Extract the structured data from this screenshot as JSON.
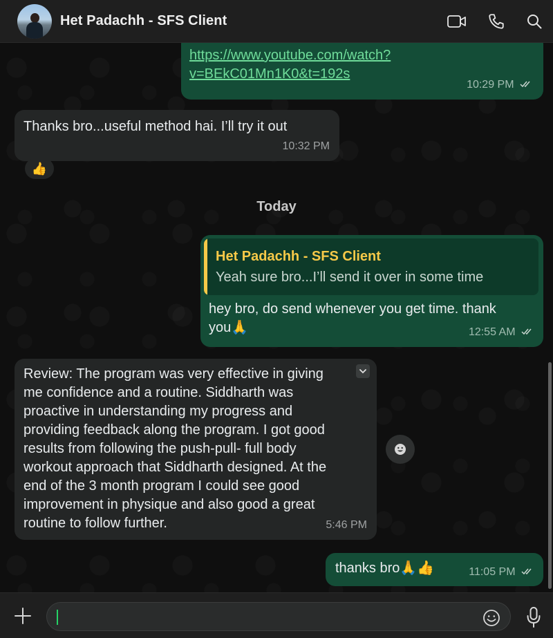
{
  "header": {
    "contact_name": "Het Padachh - SFS Client",
    "icons": [
      "video-call-icon",
      "voice-call-icon",
      "search-icon"
    ]
  },
  "messages": [
    {
      "direction": "out",
      "link_line1": "https://www.youtube.com/watch?",
      "link_line2": "v=BEkC01Mn1K0&t=192s",
      "time": "10:29 PM",
      "status": "read"
    },
    {
      "direction": "in",
      "text": "Thanks bro...useful method hai. I’ll try it out",
      "time": "10:32 PM",
      "reaction": "👍"
    },
    {
      "direction": "out",
      "quote_author": "Het Padachh - SFS Client",
      "quote_text": "Yeah sure bro...I’ll send it over in some time",
      "text_line1": "hey bro, do send whenever you get time. thank",
      "text_line2": "you🙏",
      "time": "12:55 AM",
      "status": "read"
    },
    {
      "direction": "in",
      "lines": [
        "Review: The program was very effective in giving",
        "me confidence and a routine. Siddharth was",
        "proactive in understanding my progress and",
        "providing feedback along the program. I got good",
        "results from following the push-pull- full body",
        "workout approach that Siddharth designed. At the",
        "end of the 3 month program I could see good",
        "improvement in physique and also good a great",
        "routine to follow further."
      ],
      "time": "5:46 PM"
    },
    {
      "direction": "out",
      "text": "thanks bro🙏👍",
      "time": "11:05 PM",
      "status": "read"
    }
  ],
  "day_separator": "Today",
  "composer": {
    "value": "",
    "placeholder": ""
  },
  "colors": {
    "outgoing_bubble": "#144d37",
    "incoming_bubble": "#242626",
    "quote_accent": "#f7c948",
    "link": "#6fdc9a",
    "caret": "#25d366"
  }
}
